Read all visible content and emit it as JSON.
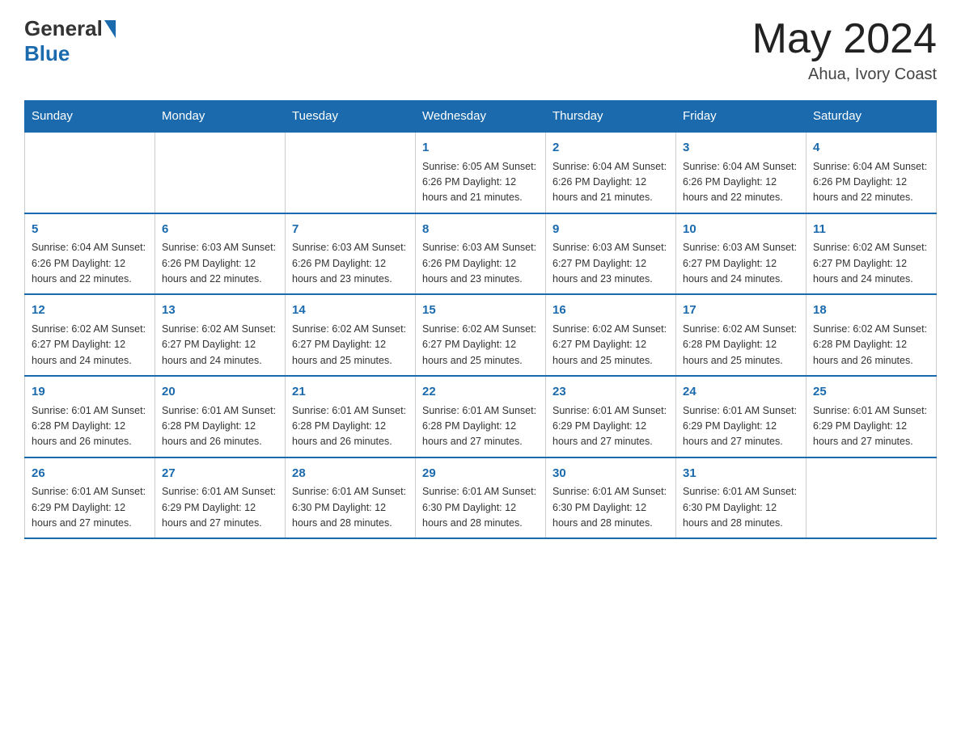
{
  "header": {
    "logo_general": "General",
    "logo_blue": "Blue",
    "month_title": "May 2024",
    "location": "Ahua, Ivory Coast"
  },
  "weekdays": [
    "Sunday",
    "Monday",
    "Tuesday",
    "Wednesday",
    "Thursday",
    "Friday",
    "Saturday"
  ],
  "weeks": [
    [
      {
        "day": "",
        "info": ""
      },
      {
        "day": "",
        "info": ""
      },
      {
        "day": "",
        "info": ""
      },
      {
        "day": "1",
        "info": "Sunrise: 6:05 AM\nSunset: 6:26 PM\nDaylight: 12 hours\nand 21 minutes."
      },
      {
        "day": "2",
        "info": "Sunrise: 6:04 AM\nSunset: 6:26 PM\nDaylight: 12 hours\nand 21 minutes."
      },
      {
        "day": "3",
        "info": "Sunrise: 6:04 AM\nSunset: 6:26 PM\nDaylight: 12 hours\nand 22 minutes."
      },
      {
        "day": "4",
        "info": "Sunrise: 6:04 AM\nSunset: 6:26 PM\nDaylight: 12 hours\nand 22 minutes."
      }
    ],
    [
      {
        "day": "5",
        "info": "Sunrise: 6:04 AM\nSunset: 6:26 PM\nDaylight: 12 hours\nand 22 minutes."
      },
      {
        "day": "6",
        "info": "Sunrise: 6:03 AM\nSunset: 6:26 PM\nDaylight: 12 hours\nand 22 minutes."
      },
      {
        "day": "7",
        "info": "Sunrise: 6:03 AM\nSunset: 6:26 PM\nDaylight: 12 hours\nand 23 minutes."
      },
      {
        "day": "8",
        "info": "Sunrise: 6:03 AM\nSunset: 6:26 PM\nDaylight: 12 hours\nand 23 minutes."
      },
      {
        "day": "9",
        "info": "Sunrise: 6:03 AM\nSunset: 6:27 PM\nDaylight: 12 hours\nand 23 minutes."
      },
      {
        "day": "10",
        "info": "Sunrise: 6:03 AM\nSunset: 6:27 PM\nDaylight: 12 hours\nand 24 minutes."
      },
      {
        "day": "11",
        "info": "Sunrise: 6:02 AM\nSunset: 6:27 PM\nDaylight: 12 hours\nand 24 minutes."
      }
    ],
    [
      {
        "day": "12",
        "info": "Sunrise: 6:02 AM\nSunset: 6:27 PM\nDaylight: 12 hours\nand 24 minutes."
      },
      {
        "day": "13",
        "info": "Sunrise: 6:02 AM\nSunset: 6:27 PM\nDaylight: 12 hours\nand 24 minutes."
      },
      {
        "day": "14",
        "info": "Sunrise: 6:02 AM\nSunset: 6:27 PM\nDaylight: 12 hours\nand 25 minutes."
      },
      {
        "day": "15",
        "info": "Sunrise: 6:02 AM\nSunset: 6:27 PM\nDaylight: 12 hours\nand 25 minutes."
      },
      {
        "day": "16",
        "info": "Sunrise: 6:02 AM\nSunset: 6:27 PM\nDaylight: 12 hours\nand 25 minutes."
      },
      {
        "day": "17",
        "info": "Sunrise: 6:02 AM\nSunset: 6:28 PM\nDaylight: 12 hours\nand 25 minutes."
      },
      {
        "day": "18",
        "info": "Sunrise: 6:02 AM\nSunset: 6:28 PM\nDaylight: 12 hours\nand 26 minutes."
      }
    ],
    [
      {
        "day": "19",
        "info": "Sunrise: 6:01 AM\nSunset: 6:28 PM\nDaylight: 12 hours\nand 26 minutes."
      },
      {
        "day": "20",
        "info": "Sunrise: 6:01 AM\nSunset: 6:28 PM\nDaylight: 12 hours\nand 26 minutes."
      },
      {
        "day": "21",
        "info": "Sunrise: 6:01 AM\nSunset: 6:28 PM\nDaylight: 12 hours\nand 26 minutes."
      },
      {
        "day": "22",
        "info": "Sunrise: 6:01 AM\nSunset: 6:28 PM\nDaylight: 12 hours\nand 27 minutes."
      },
      {
        "day": "23",
        "info": "Sunrise: 6:01 AM\nSunset: 6:29 PM\nDaylight: 12 hours\nand 27 minutes."
      },
      {
        "day": "24",
        "info": "Sunrise: 6:01 AM\nSunset: 6:29 PM\nDaylight: 12 hours\nand 27 minutes."
      },
      {
        "day": "25",
        "info": "Sunrise: 6:01 AM\nSunset: 6:29 PM\nDaylight: 12 hours\nand 27 minutes."
      }
    ],
    [
      {
        "day": "26",
        "info": "Sunrise: 6:01 AM\nSunset: 6:29 PM\nDaylight: 12 hours\nand 27 minutes."
      },
      {
        "day": "27",
        "info": "Sunrise: 6:01 AM\nSunset: 6:29 PM\nDaylight: 12 hours\nand 27 minutes."
      },
      {
        "day": "28",
        "info": "Sunrise: 6:01 AM\nSunset: 6:30 PM\nDaylight: 12 hours\nand 28 minutes."
      },
      {
        "day": "29",
        "info": "Sunrise: 6:01 AM\nSunset: 6:30 PM\nDaylight: 12 hours\nand 28 minutes."
      },
      {
        "day": "30",
        "info": "Sunrise: 6:01 AM\nSunset: 6:30 PM\nDaylight: 12 hours\nand 28 minutes."
      },
      {
        "day": "31",
        "info": "Sunrise: 6:01 AM\nSunset: 6:30 PM\nDaylight: 12 hours\nand 28 minutes."
      },
      {
        "day": "",
        "info": ""
      }
    ]
  ]
}
